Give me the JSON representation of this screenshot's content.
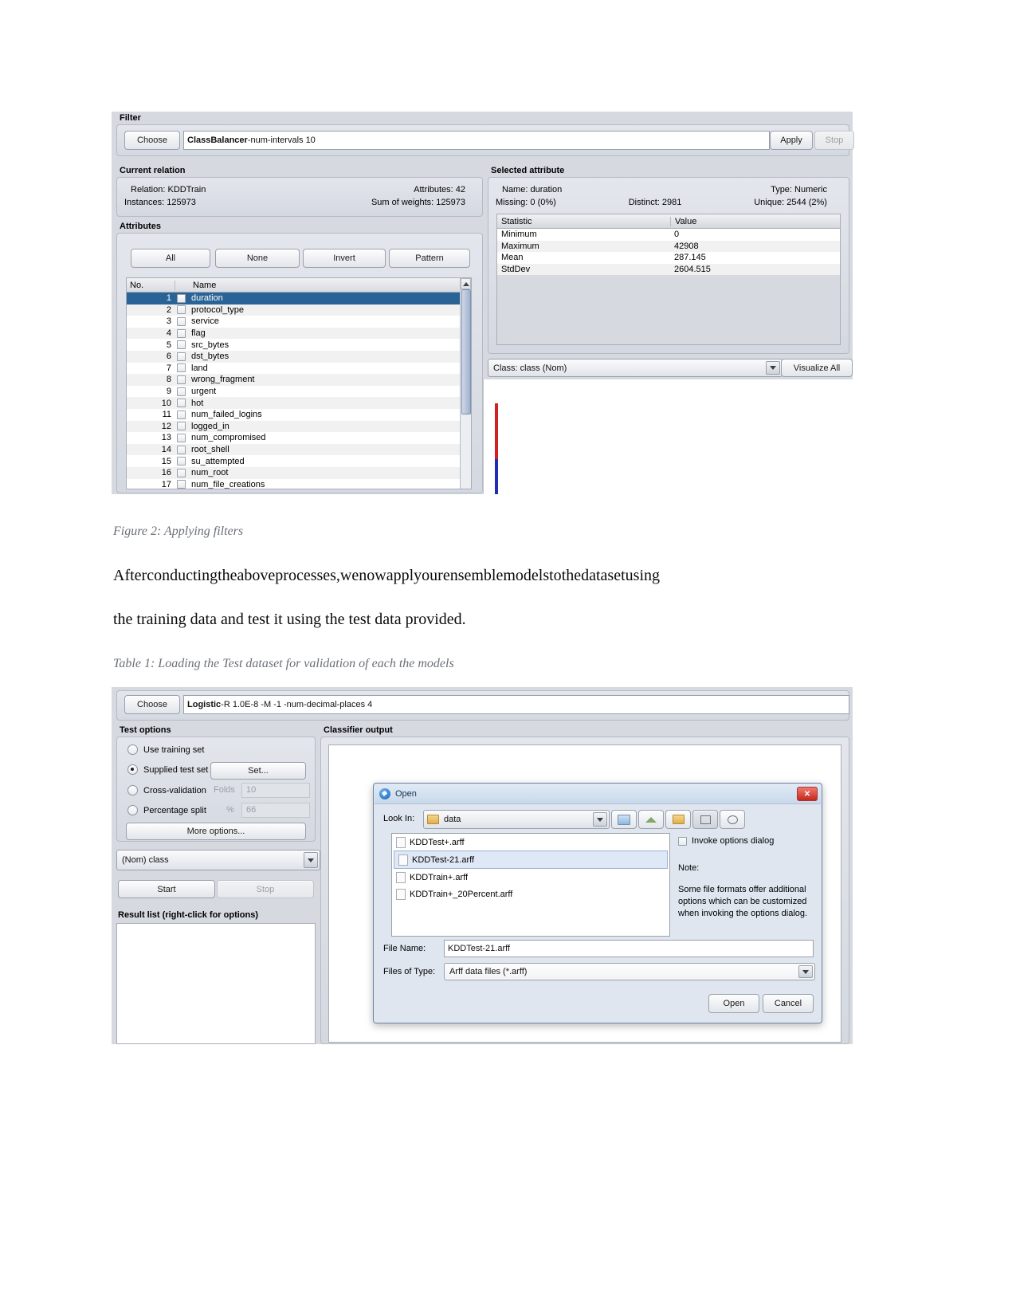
{
  "document": {
    "figure2_caption": "Figure 2: Applying filters",
    "paragraph_line1_words": [
      "After",
      "conducting",
      "the",
      "above",
      "processes,",
      "we",
      "now",
      "apply",
      "our",
      "ensemble",
      "models",
      "to",
      "the",
      "dataset",
      "using"
    ],
    "paragraph_line2": "the training data and test it using the test data provided.",
    "table1_caption": "Table 1: Loading the Test dataset for validation of each the models"
  },
  "figure2": {
    "filter": {
      "group_label": "Filter",
      "choose_button": "Choose",
      "filter_value_bold": "ClassBalancer",
      "filter_value_rest": " -num-intervals 10",
      "apply_button": "Apply",
      "stop_button": "Stop"
    },
    "current_relation": {
      "group_label": "Current relation",
      "relation_label": "Relation:",
      "relation_value": "KDDTrain",
      "instances_label": "Instances:",
      "instances_value": "125973",
      "attributes_label": "Attributes:",
      "attributes_value": "42",
      "sum_weights_label": "Sum of weights:",
      "sum_weights_value": "125973"
    },
    "attributes": {
      "group_label": "Attributes",
      "buttons": [
        "All",
        "None",
        "Invert",
        "Pattern"
      ],
      "columns": [
        "No.",
        "Name"
      ],
      "rows": [
        {
          "no": "1",
          "name": "duration"
        },
        {
          "no": "2",
          "name": "protocol_type"
        },
        {
          "no": "3",
          "name": "service"
        },
        {
          "no": "4",
          "name": "flag"
        },
        {
          "no": "5",
          "name": "src_bytes"
        },
        {
          "no": "6",
          "name": "dst_bytes"
        },
        {
          "no": "7",
          "name": "land"
        },
        {
          "no": "8",
          "name": "wrong_fragment"
        },
        {
          "no": "9",
          "name": "urgent"
        },
        {
          "no": "10",
          "name": "hot"
        },
        {
          "no": "11",
          "name": "num_failed_logins"
        },
        {
          "no": "12",
          "name": "logged_in"
        },
        {
          "no": "13",
          "name": "num_compromised"
        },
        {
          "no": "14",
          "name": "root_shell"
        },
        {
          "no": "15",
          "name": "su_attempted"
        },
        {
          "no": "16",
          "name": "num_root"
        },
        {
          "no": "17",
          "name": "num_file_creations"
        }
      ],
      "selected_row_index": 0
    },
    "selected_attribute": {
      "group_label": "Selected attribute",
      "name_label": "Name:",
      "name_value": "duration",
      "type_label": "Type:",
      "type_value": "Numeric",
      "missing_label": "Missing:",
      "missing_value": "0 (0%)",
      "distinct_label": "Distinct:",
      "distinct_value": "2981",
      "unique_label": "Unique:",
      "unique_value": "2544 (2%)",
      "stat_columns": [
        "Statistic",
        "Value"
      ],
      "stats": [
        {
          "statistic": "Minimum",
          "value": "0"
        },
        {
          "statistic": "Maximum",
          "value": "42908"
        },
        {
          "statistic": "Mean",
          "value": "287.145"
        },
        {
          "statistic": "StdDev",
          "value": "2604.515"
        }
      ]
    },
    "class_selector": {
      "value": "Class: class (Nom)",
      "visualize_button": "Visualize All"
    },
    "histogram": {
      "bar_colors": [
        "#cf2222",
        "#1f2fb4"
      ]
    }
  },
  "table1": {
    "classifier": {
      "choose_button": "Choose",
      "classifier_bold": "Logistic",
      "classifier_rest": " -R 1.0E-8 -M -1 -num-decimal-places 4"
    },
    "test_options": {
      "group_label": "Test options",
      "options": [
        {
          "label": "Use training set",
          "selected": false
        },
        {
          "label": "Supplied test set",
          "selected": true
        },
        {
          "label": "Cross-validation",
          "selected": false
        },
        {
          "label": "Percentage split",
          "selected": false
        }
      ],
      "set_button": "Set...",
      "folds_label": "Folds",
      "folds_value": "10",
      "percent_label": "%",
      "percent_value": "66",
      "more_options_button": "More options..."
    },
    "class_combo_value": "(Nom) class",
    "start_button": "Start",
    "stop_button": "Stop",
    "result_list_label": "Result list (right-click for options)",
    "classifier_output_label": "Classifier output"
  },
  "open_dialog": {
    "title": "Open",
    "look_in_label": "Look In:",
    "look_in_value": "data",
    "toolbar_icons": [
      "up-folder-icon",
      "home-icon",
      "new-folder-icon",
      "list-view-icon",
      "details-view-icon"
    ],
    "files": [
      {
        "name": "KDDTest+.arff",
        "selected": false
      },
      {
        "name": "KDDTest-21.arff",
        "selected": true
      },
      {
        "name": "KDDTrain+.arff",
        "selected": false
      },
      {
        "name": "KDDTrain+_20Percent.arff",
        "selected": false
      }
    ],
    "invoke_options_label": "Invoke options dialog",
    "note_label": "Note:",
    "note_lines": [
      "Some file formats offer additional",
      "options which can be customized",
      "when invoking the options dialog."
    ],
    "file_name_label": "File Name:",
    "file_name_value": "KDDTest-21.arff",
    "files_of_type_label": "Files of Type:",
    "files_of_type_value": "Arff data files (*.arff)",
    "open_button": "Open",
    "cancel_button": "Cancel"
  }
}
